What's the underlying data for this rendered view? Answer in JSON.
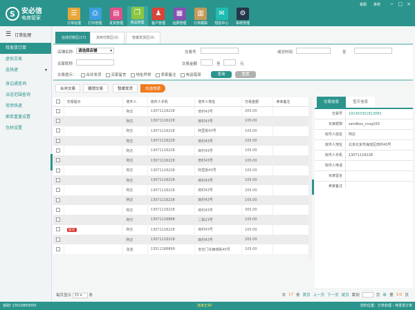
{
  "app": {
    "logo_main": "安必信",
    "logo_sub": "电商管家",
    "top_links": [
      "客服",
      "系统"
    ],
    "window_controls": [
      "−",
      "□",
      "×"
    ]
  },
  "nav": [
    {
      "label": "订单处理",
      "icon": "order-icon",
      "color": "#e8a63a",
      "glyph": "☰"
    },
    {
      "label": "打印管理",
      "icon": "printer-icon",
      "color": "#3d9ee0",
      "glyph": "⎙"
    },
    {
      "label": "发货管理",
      "icon": "chart-icon",
      "color": "#e0508a",
      "glyph": "▤"
    },
    {
      "label": "商品管理",
      "icon": "box-icon",
      "color": "#8cc63f",
      "glyph": "❒"
    },
    {
      "label": "客户管理",
      "icon": "user-icon",
      "color": "#d9433a",
      "glyph": "♟"
    },
    {
      "label": "运费管理",
      "icon": "calculator-icon",
      "color": "#8a4fb3",
      "glyph": "▦"
    },
    {
      "label": "订单跟踪",
      "icon": "clipboard-icon",
      "color": "#c49a5a",
      "glyph": "▥"
    },
    {
      "label": "短信中心",
      "icon": "mail-icon",
      "color": "#1fbcb2",
      "glyph": "✉"
    },
    {
      "label": "系统管理",
      "icon": "gear-icon",
      "color": "#26364a",
      "glyph": "⚙"
    }
  ],
  "sidebar": {
    "title": "订单处理",
    "items": [
      {
        "label": "待发货订单"
      },
      {
        "label": "虚拟交易"
      },
      {
        "label": "选快递",
        "dropdown": "▾"
      },
      {
        "label": "身边通查询"
      },
      {
        "label": "派送范围查询"
      },
      {
        "label": "常用快递"
      },
      {
        "label": "面单重量设置"
      },
      {
        "label": "包材设置"
      }
    ]
  },
  "tabs": [
    "在线付款区(17)",
    "货到付款区(0)",
    "暂缓发货区(0)"
  ],
  "filter": {
    "shop_label": "店铺名称:",
    "shop_value": "请选择店铺",
    "buyer_label": "买家昵称",
    "trade_no_label": "交易号",
    "amount_label": "交易金额",
    "to": "至",
    "yuan": "元",
    "deal_time_label": "成交时间",
    "hint_label": "交易提示：",
    "hints": [
      "合并发货",
      "买家留言",
      "地址异常",
      "卖家备注",
      "电话错误"
    ],
    "search": "查询",
    "reset": "重置"
  },
  "actions": [
    "合并交易",
    "撤销交易",
    "暂缓发货",
    "去选快递"
  ],
  "table": {
    "headers": [
      "交易提示",
      "收件人",
      "收件人手机",
      "收件人地址",
      "交易金额",
      "卖家备注"
    ],
    "rows": [
      [
        "",
        "阿达",
        "13071118228",
        "田村43号",
        "205.00",
        ""
      ],
      [
        "",
        "阿达",
        "13071118228",
        "田村43号",
        "105.00",
        ""
      ],
      [
        "",
        "阿达",
        "13071118228",
        "阿里街43号",
        "105.00",
        ""
      ],
      [
        "",
        "阿达",
        "13071118228",
        "田村43号",
        "105.00",
        ""
      ],
      [
        "",
        "阿达",
        "13071118228",
        "田村43号",
        "105.00",
        ""
      ],
      [
        "",
        "阿达",
        "13071118228",
        "田村43号",
        "105.00",
        ""
      ],
      [
        "",
        "阿达",
        "13071118228",
        "阿里街43号",
        "105.00",
        ""
      ],
      [
        "",
        "阿达",
        "13071118228",
        "田村43号",
        "105.00",
        ""
      ],
      [
        "",
        "阿达",
        "13071118228",
        "田村43号",
        "205.00",
        ""
      ],
      [
        "",
        "阿达",
        "13071118228",
        "田村43号",
        "105.00",
        ""
      ],
      [
        "",
        "阿达",
        "13071118228",
        "田村43号",
        "305.00",
        ""
      ],
      [
        "",
        "阿尔",
        "13071118888",
        "二街23号",
        "105.00",
        ""
      ],
      [
        "留言",
        "阿达",
        "13071118228",
        "田村43号",
        "105.00",
        ""
      ],
      [
        "",
        "阿达",
        "13071118228",
        "田村43号",
        "205.00",
        ""
      ],
      [
        "",
        "张迷",
        "13511188899",
        "安定门车辆城街45号",
        "105.00",
        ""
      ]
    ]
  },
  "detail": {
    "tabs": [
      "交易信息",
      "宝贝信息"
    ],
    "rows": [
      {
        "k": "交易号",
        "v": "1923633018130B1"
      },
      {
        "k": "买家昵称",
        "v": "sandbox_cnsg100"
      },
      {
        "k": "收件人姓名",
        "v": "阿达"
      },
      {
        "k": "收件人地址",
        "v": "北京北京市海淀区田村43号"
      },
      {
        "k": "收件人手机",
        "v": "13071118228"
      },
      {
        "k": "收件人电话",
        "v": ""
      },
      {
        "k": "买家留言",
        "v": ""
      },
      {
        "k": "卖家备注",
        "v": ""
      }
    ]
  },
  "pager": {
    "per_page_label": "每页显示",
    "per_page": "15",
    "unit": "条",
    "total_prefix": "共",
    "total": "17",
    "total_suffix": "条",
    "first": "首页",
    "prev": "上一页",
    "next": "下一页",
    "last": "尾页",
    "jump": "跳到",
    "page_unit": "页",
    "page_prefix": "第",
    "page": "1/2",
    "page_suffix": "页"
  },
  "status": {
    "left": "自助! 13510850050",
    "center": "连接正常!",
    "right": "您的位置：订单处理 › 待发货订单"
  }
}
